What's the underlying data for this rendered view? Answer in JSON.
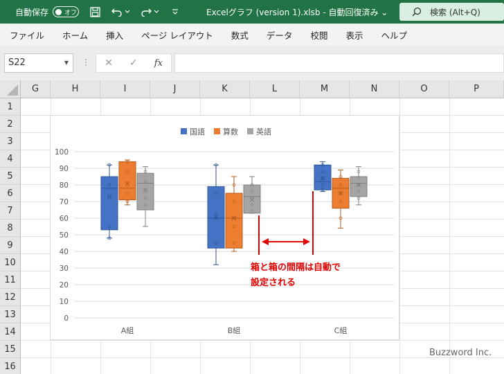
{
  "titlebar": {
    "autosave_label": "自動保存",
    "toggle_label": "オフ",
    "doc_title": "Excelグラフ (version 1).xlsb  -  自動回復済み  ⌄",
    "search_label": "検索 (Alt+Q)"
  },
  "menu": [
    "ファイル",
    "ホーム",
    "挿入",
    "ページ レイアウト",
    "数式",
    "データ",
    "校閲",
    "表示",
    "ヘルプ"
  ],
  "formula_bar": {
    "name_box": "S22",
    "fx_label": "fx",
    "formula": ""
  },
  "columns": [
    "G",
    "H",
    "I",
    "J",
    "K",
    "L",
    "M",
    "N",
    "O",
    "P"
  ],
  "rows": [
    "1",
    "2",
    "3",
    "4",
    "5",
    "6",
    "7",
    "8",
    "9",
    "10",
    "11",
    "12",
    "13",
    "14",
    "15",
    "16"
  ],
  "chart_data": {
    "type": "boxplot",
    "categories": [
      "A組",
      "B組",
      "C組"
    ],
    "ylim": [
      0,
      100
    ],
    "yticks": [
      "0",
      "10",
      "20",
      "30",
      "40",
      "50",
      "60",
      "70",
      "80",
      "90",
      "100"
    ],
    "legend_position": "top",
    "grid": true,
    "series": [
      {
        "name": "国語",
        "color": "#4472c4",
        "boxes": [
          {
            "min": 48,
            "q1": 53,
            "median": 78,
            "q3": 85,
            "max": 92,
            "mean": 73,
            "points": [
              48,
              55,
              72,
              80,
              92
            ]
          },
          {
            "min": 32,
            "q1": 42,
            "median": 60,
            "q3": 79,
            "max": 92,
            "mean": 61,
            "points": [
              45,
              60,
              63,
              75,
              92
            ]
          },
          {
            "min": 76,
            "q1": 77,
            "median": 82,
            "q3": 92,
            "max": 94,
            "mean": 84,
            "points": [
              77,
              80,
              84,
              88,
              92
            ]
          }
        ]
      },
      {
        "name": "算数",
        "color": "#ed7d31",
        "boxes": [
          {
            "min": 68,
            "q1": 71,
            "median": 78,
            "q3": 94,
            "max": 95,
            "mean": 81,
            "points": [
              70,
              75,
              80,
              88,
              94
            ]
          },
          {
            "min": 40,
            "q1": 42,
            "median": 60,
            "q3": 75,
            "max": 85,
            "mean": 60,
            "points": [
              45,
              55,
              60,
              70,
              80
            ]
          },
          {
            "min": 54,
            "q1": 66,
            "median": 78,
            "q3": 84,
            "max": 89,
            "mean": 75,
            "points": [
              60,
              70,
              75,
              80,
              85
            ]
          }
        ]
      },
      {
        "name": "英語",
        "color": "#a5a5a5",
        "boxes": [
          {
            "min": 55,
            "q1": 65,
            "median": 81,
            "q3": 87,
            "max": 91,
            "mean": 77,
            "points": [
              68,
              72,
              76,
              82,
              88
            ]
          },
          {
            "min": 63,
            "q1": 63,
            "median": 73,
            "q3": 80,
            "max": 85,
            "mean": 71,
            "points": [
              64,
              68,
              72,
              76,
              80
            ]
          },
          {
            "min": 68,
            "q1": 73,
            "median": 81,
            "q3": 85,
            "max": 91,
            "mean": 80,
            "points": [
              72,
              76,
              80,
              84,
              88
            ]
          }
        ]
      }
    ]
  },
  "annotation": {
    "line1": "箱と箱の間隔は自動で",
    "line2": "設定される",
    "color": "#e00000"
  },
  "watermark": "Buzzword Inc."
}
